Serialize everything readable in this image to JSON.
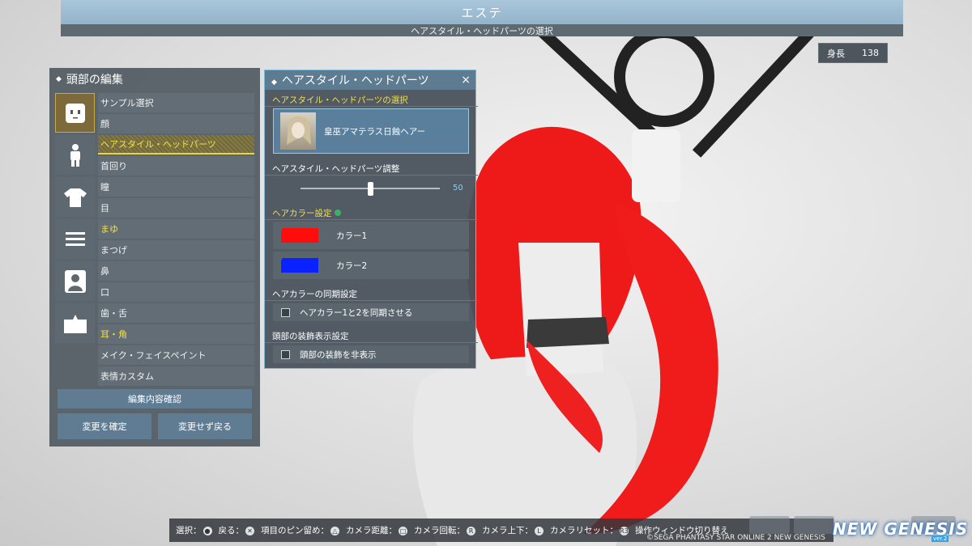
{
  "header": {
    "title": "エステ",
    "subtitle": "ヘアスタイル・ヘッドパーツの選択",
    "height_label": "身長",
    "height_value": "138"
  },
  "left_panel": {
    "title": "頭部の編集",
    "category_icons": [
      "face-icon",
      "body-icon",
      "shirt-icon",
      "menu-icon",
      "portrait-icon",
      "folder-icon"
    ],
    "menu_items": [
      {
        "label": "サンプル選択",
        "state": "normal"
      },
      {
        "label": "顔",
        "state": "normal"
      },
      {
        "label": "ヘアスタイル・ヘッドパーツ",
        "state": "selected"
      },
      {
        "label": "首回り",
        "state": "normal"
      },
      {
        "label": "瞳",
        "state": "normal"
      },
      {
        "label": "目",
        "state": "normal"
      },
      {
        "label": "まゆ",
        "state": "highlight"
      },
      {
        "label": "まつげ",
        "state": "normal"
      },
      {
        "label": "鼻",
        "state": "normal"
      },
      {
        "label": "口",
        "state": "normal"
      },
      {
        "label": "歯・舌",
        "state": "normal"
      },
      {
        "label": "耳・角",
        "state": "highlight"
      },
      {
        "label": "メイク・フェイスペイント",
        "state": "normal"
      },
      {
        "label": "表情カスタム",
        "state": "normal"
      }
    ],
    "review_button": "編集内容確認",
    "confirm_button": "変更を確定",
    "back_button": "変更せず戻る"
  },
  "right_panel": {
    "title": "ヘアスタイル・ヘッドパーツ",
    "close_glyph": "×",
    "select_section": "ヘアスタイル・ヘッドパーツの選択",
    "selected_hair": "皇巫アマテラス日蝕ヘアー",
    "adjust_section": "ヘアスタイル・ヘッドパーツ調整",
    "slider_value": 50,
    "slider_max": 100,
    "color_section": "ヘアカラー設定",
    "colors": [
      {
        "label": "カラー1",
        "hex": "#ff0d0d"
      },
      {
        "label": "カラー2",
        "hex": "#0a22ff"
      }
    ],
    "sync_section": "ヘアカラーの同期設定",
    "sync_checkbox": "ヘアカラー1と2を同期させる",
    "ornament_section": "頭部の装飾表示設定",
    "ornament_checkbox": "頭部の装飾を非表示"
  },
  "help_bar": {
    "items": [
      {
        "label": "選択：",
        "button": "●"
      },
      {
        "label": "戻る：",
        "button": "✕"
      },
      {
        "label": "項目のピン留め：",
        "button": "△"
      },
      {
        "label": "カメラ距離：",
        "button": "□"
      },
      {
        "label": "カメラ回転：",
        "button": "R"
      },
      {
        "label": "カメラ上下：",
        "button": "L"
      },
      {
        "label": "カメラリセット：",
        "button": "R3"
      },
      {
        "label": "操作ウィンドウ切り替え",
        "button": ""
      }
    ],
    "copyright": "©SEGA PHANTASY STAR ONLINE 2 NEW GENESIS",
    "logo": "NEW GENESIS",
    "logo_version": "ver.2"
  }
}
